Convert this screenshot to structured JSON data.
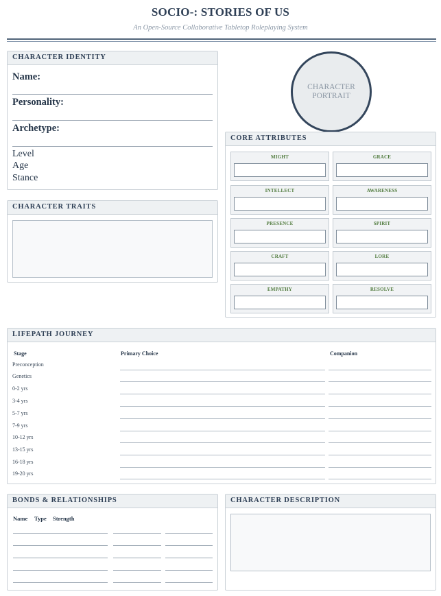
{
  "header": {
    "title": "SOCIO-: STORIES OF US",
    "subtitle": "An Open-Source Collaborative Tabletop Roleplaying System"
  },
  "identity": {
    "heading": "CHARACTER IDENTITY",
    "name_label": "Name:",
    "personality_label": "Personality:",
    "archetype_label": "Archetype:",
    "level_label": "Level",
    "age_label": "Age",
    "stance_label": "Stance"
  },
  "traits": {
    "heading": "CHARACTER TRAITS"
  },
  "portrait": {
    "line1": "CHARACTER",
    "line2": "PORTRAIT"
  },
  "attributes": {
    "heading": "CORE ATTRIBUTES",
    "items": [
      "MIGHT",
      "GRACE",
      "INTELLECT",
      "AWARENESS",
      "PRESENCE",
      "SPIRIT",
      "CRAFT",
      "LORE",
      "EMPATHY",
      "RESOLVE"
    ]
  },
  "lifepath": {
    "heading": "LIFEPATH JOURNEY",
    "columns": [
      "Stage",
      "Primary Choice",
      "Companion"
    ],
    "stages": [
      "Preconception",
      "Genetics",
      "0-2 yrs",
      "3-4 yrs",
      "5-7 yrs",
      "7-9 yrs",
      "10-12 yrs",
      "13-15 yrs",
      "16-18 yrs",
      "19-20 yrs"
    ]
  },
  "bonds": {
    "heading": "BONDS & RELATIONSHIPS",
    "columns": [
      "Name",
      "Type",
      "Strength"
    ]
  },
  "description": {
    "heading": "CHARACTER DESCRIPTION"
  },
  "colors": {
    "primary": "#2e3f55",
    "accent_green": "#4f7a3c",
    "panel_head": "#eef1f3"
  }
}
